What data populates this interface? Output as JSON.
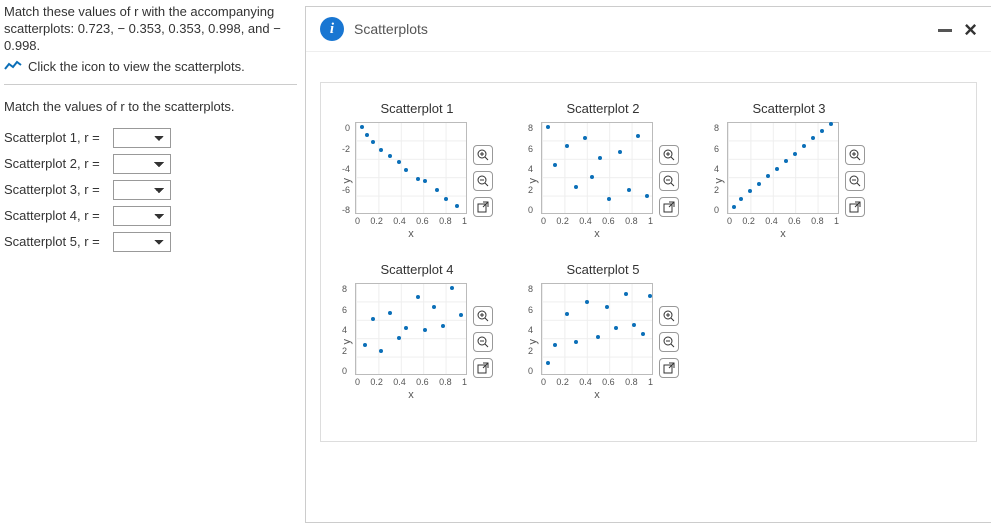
{
  "instruction": "Match these values of r with the accompanying scatterplots: 0.723, − 0.353, 0.353, 0.998, and − 0.998.",
  "click_line": "Click the icon to view the scatterplots.",
  "match_header": "Match the values of r to the scatterplots.",
  "panel_title": "Scatterplots",
  "rows": [
    {
      "label": "Scatterplot 1, r ="
    },
    {
      "label": "Scatterplot 2, r ="
    },
    {
      "label": "Scatterplot 3, r ="
    },
    {
      "label": "Scatterplot 4, r ="
    },
    {
      "label": "Scatterplot 5, r ="
    }
  ],
  "axis": {
    "x": "x",
    "y": "y",
    "xticks": [
      "0",
      "0.2",
      "0.4",
      "0.6",
      "0.8",
      "1"
    ]
  },
  "chart_data": [
    {
      "type": "scatter",
      "title": "Scatterplot 1",
      "xlabel": "x",
      "ylabel": "y",
      "xlim": [
        0,
        1
      ],
      "ylim": [
        -8,
        0
      ],
      "yticks": [
        0,
        -2,
        -4,
        -6,
        -8
      ],
      "x": [
        0.05,
        0.1,
        0.15,
        0.22,
        0.3,
        0.38,
        0.45,
        0.55,
        0.62,
        0.72,
        0.8,
        0.9
      ],
      "y": [
        -0.5,
        -1.2,
        -1.8,
        -2.5,
        -3.0,
        -3.6,
        -4.3,
        -5.0,
        -5.2,
        -6.0,
        -6.8,
        -7.4
      ]
    },
    {
      "type": "scatter",
      "title": "Scatterplot 2",
      "xlabel": "x",
      "ylabel": "y",
      "xlim": [
        0,
        1
      ],
      "ylim": [
        0,
        8
      ],
      "yticks": [
        8,
        6,
        4,
        2,
        0
      ],
      "x": [
        0.05,
        0.12,
        0.22,
        0.3,
        0.38,
        0.45,
        0.52,
        0.6,
        0.7,
        0.78,
        0.86,
        0.94
      ],
      "y": [
        7.5,
        4.2,
        5.8,
        2.3,
        6.5,
        3.1,
        4.8,
        1.2,
        5.3,
        2.0,
        6.7,
        1.5
      ]
    },
    {
      "type": "scatter",
      "title": "Scatterplot 3",
      "xlabel": "x",
      "ylabel": "y",
      "xlim": [
        0,
        1
      ],
      "ylim": [
        0,
        8
      ],
      "yticks": [
        8,
        6,
        4,
        2,
        0
      ],
      "x": [
        0.05,
        0.12,
        0.2,
        0.28,
        0.36,
        0.44,
        0.52,
        0.6,
        0.68,
        0.76,
        0.84,
        0.92
      ],
      "y": [
        0.5,
        1.2,
        1.9,
        2.5,
        3.2,
        3.8,
        4.5,
        5.1,
        5.8,
        6.5,
        7.1,
        7.7
      ]
    },
    {
      "type": "scatter",
      "title": "Scatterplot 4",
      "xlabel": "x",
      "ylabel": "y",
      "xlim": [
        0,
        1
      ],
      "ylim": [
        0,
        8
      ],
      "yticks": [
        8,
        6,
        4,
        2,
        0
      ],
      "x": [
        0.08,
        0.15,
        0.22,
        0.3,
        0.38,
        0.45,
        0.55,
        0.62,
        0.7,
        0.78,
        0.86,
        0.94
      ],
      "y": [
        2.5,
        4.8,
        2.0,
        5.3,
        3.1,
        4.0,
        6.7,
        3.8,
        5.8,
        4.2,
        7.5,
        5.1
      ]
    },
    {
      "type": "scatter",
      "title": "Scatterplot 5",
      "xlabel": "x",
      "ylabel": "y",
      "xlim": [
        0,
        1
      ],
      "ylim": [
        0,
        8
      ],
      "yticks": [
        8,
        6,
        4,
        2,
        0
      ],
      "x": [
        0.05,
        0.12,
        0.22,
        0.3,
        0.4,
        0.5,
        0.58,
        0.66,
        0.75,
        0.82,
        0.9,
        0.96
      ],
      "y": [
        1.0,
        2.5,
        5.2,
        2.8,
        6.3,
        3.2,
        5.8,
        4.0,
        7.0,
        4.3,
        3.5,
        6.8
      ]
    }
  ]
}
